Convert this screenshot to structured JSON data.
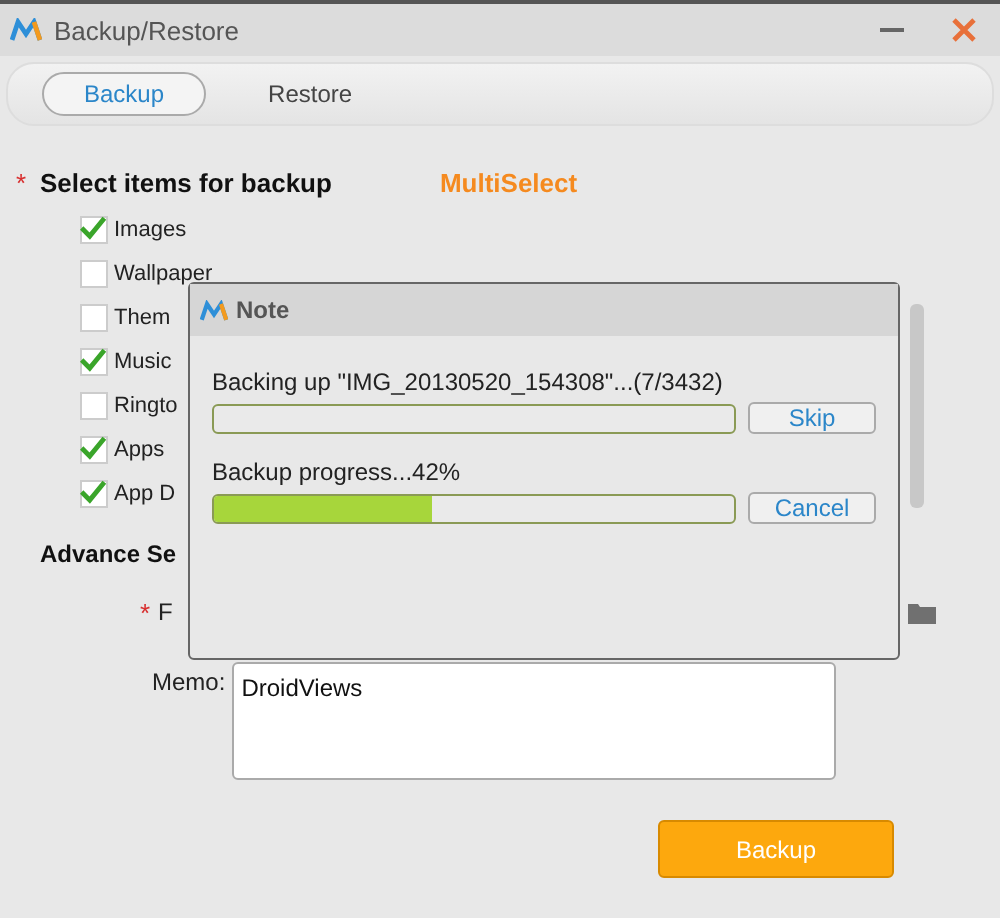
{
  "window": {
    "title": "Backup/Restore"
  },
  "tabs": [
    {
      "label": "Backup",
      "selected": true
    },
    {
      "label": "Restore",
      "selected": false
    }
  ],
  "select_section": {
    "marker": "*",
    "title": "Select items for backup",
    "multi_select": "MultiSelect"
  },
  "items": [
    {
      "label": "Images",
      "checked": true
    },
    {
      "label": "Wallpaper",
      "checked": false
    },
    {
      "label": "Them",
      "checked": false
    },
    {
      "label": "Music",
      "checked": true
    },
    {
      "label": "Ringto",
      "checked": false
    },
    {
      "label": "Apps",
      "checked": true
    },
    {
      "label": "App D",
      "checked": true
    }
  ],
  "advance_section": {
    "title": "Advance Se",
    "path_marker": "*",
    "path_label": "F"
  },
  "memo": {
    "label": "Memo:",
    "value": "DroidViews"
  },
  "backup_button": "Backup",
  "dialog": {
    "title": "Note",
    "rows": [
      {
        "label": "Backing up \"IMG_20130520_154308\"...(7/3432)",
        "level": 0,
        "button": "Skip"
      },
      {
        "label": "Backup progress...42%",
        "level": 0.42,
        "button": "Cancel"
      }
    ]
  }
}
